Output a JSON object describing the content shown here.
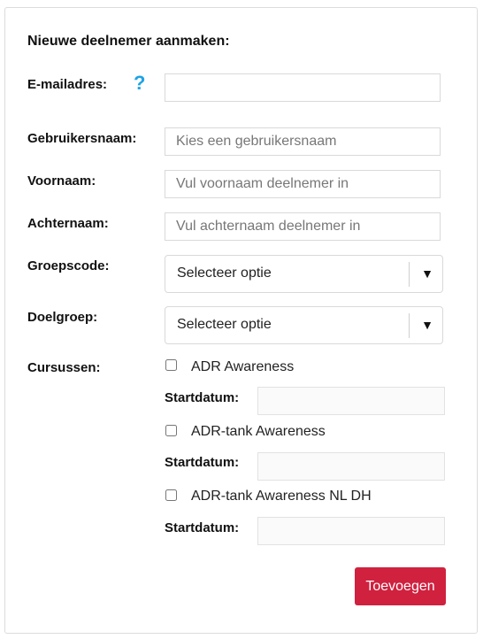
{
  "form": {
    "title": "Nieuwe deelnemer aanmaken:",
    "help_icon": "?",
    "fields": {
      "email": {
        "label": "E-mailadres:",
        "value": "",
        "placeholder": ""
      },
      "username": {
        "label": "Gebruikersnaam:",
        "value": "",
        "placeholder": "Kies een gebruikersnaam"
      },
      "firstname": {
        "label": "Voornaam:",
        "value": "",
        "placeholder": "Vul voornaam deelnemer in"
      },
      "lastname": {
        "label": "Achternaam:",
        "value": "",
        "placeholder": "Vul achternaam deelnemer in"
      },
      "groupcode": {
        "label": "Groepscode:",
        "selected": "Selecteer optie",
        "caret": "▼"
      },
      "targetgroup": {
        "label": "Doelgroep:",
        "selected": "Selecteer optie",
        "caret": "▼"
      }
    },
    "courses": {
      "label": "Cursussen:",
      "start_label": "Startdatum:",
      "items": [
        {
          "name": "ADR Awareness",
          "checked": false,
          "start_date": ""
        },
        {
          "name": "ADR-tank Awareness",
          "checked": false,
          "start_date": ""
        },
        {
          "name": "ADR-tank Awareness NL DH",
          "checked": false,
          "start_date": ""
        }
      ]
    },
    "submit_label": "Toevoegen",
    "colors": {
      "accent": "#d0213f",
      "help": "#1fa3e4",
      "border": "#d9d9d9"
    },
    "icons": {
      "help": "question-mark-icon",
      "dropdown": "chevron-down-icon"
    }
  }
}
